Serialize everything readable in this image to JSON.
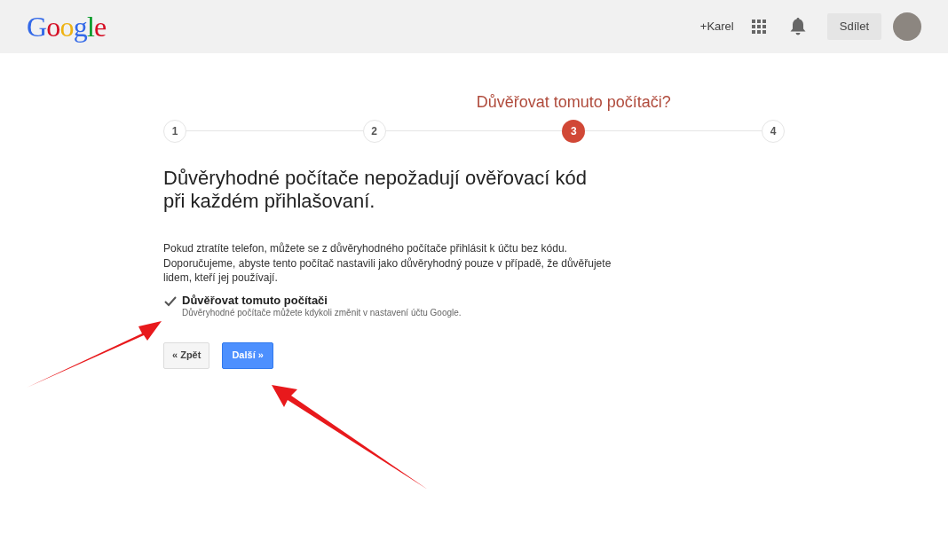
{
  "header": {
    "logo": "Google",
    "profile_link": "+Karel",
    "share_button": "Sdílet"
  },
  "wizard": {
    "step_title": "Důvěřovat tomuto počítači?",
    "steps": [
      {
        "label": "1",
        "selected": false
      },
      {
        "label": "2",
        "selected": false
      },
      {
        "label": "3",
        "selected": true
      },
      {
        "label": "4",
        "selected": false
      }
    ]
  },
  "heading": "Důvěryhodné počítače nepožadují ověřovací kód při každém přihlašovaní.",
  "description": "Pokud ztratíte telefon, můžete se z důvěryhodného počítače přihlásit k účtu bez kódu. Doporučujeme, abyste tento počítač nastavili jako důvěryhodný pouze v případě, že důvěřujete lidem, kteří jej používají.",
  "trust_option": {
    "label": "Důvěřovat tomuto počítači",
    "hint": "Důvěryhodné počítače můžete kdykoli změnit v nastavení účtu Google.",
    "checked": true
  },
  "buttons": [
    {
      "label": "« Zpět",
      "kind": "secondary"
    },
    {
      "label": "Další »",
      "kind": "primary"
    }
  ]
}
